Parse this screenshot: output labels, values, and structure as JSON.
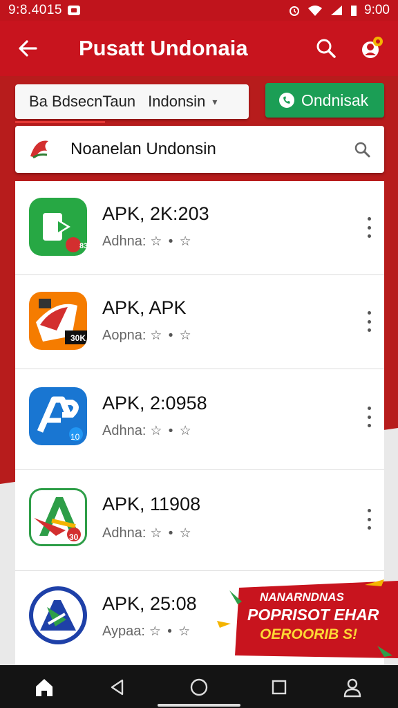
{
  "status_bar": {
    "time_left": "9:8.4015",
    "time_right": "9:00"
  },
  "app_bar": {
    "title": "Pusatt Undonaia"
  },
  "filter": {
    "label_a": "Ba Bdsecn",
    "label_b": "Taun",
    "label_c": "Indonsin"
  },
  "action_button": {
    "label": "Ondnisak"
  },
  "search": {
    "value": "Noanelan Undonsin"
  },
  "apps": [
    {
      "name": "APK, 2K:203",
      "meta": "Adhna:",
      "stars": "☆ • ☆",
      "badge": "83"
    },
    {
      "name": "APK, APK",
      "meta": "Aopna:",
      "stars": "☆ • ☆",
      "badge": "30K"
    },
    {
      "name": "APK, 2:0958",
      "meta": "Adhna:",
      "stars": "☆ • ☆",
      "badge": "10"
    },
    {
      "name": "APK, 11908",
      "meta": "Adhna:",
      "stars": "☆ • ☆",
      "badge": "30"
    },
    {
      "name": "APK, 25:08",
      "meta": "Aypaa:",
      "stars": "☆ • ☆"
    }
  ],
  "promo": {
    "line1": "NANARNDNAS",
    "line2": "POPRISOT EHAR",
    "line3": "OEROORIB S!"
  },
  "colors": {
    "primary": "#c8141e",
    "accent_green": "#1b9e55",
    "nav": "#141414"
  }
}
